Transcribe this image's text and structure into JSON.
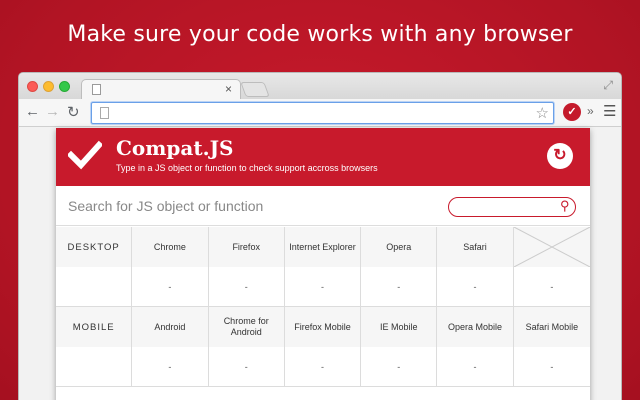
{
  "headline": "Make sure your code works with any browser",
  "browser": {
    "tab_close": "×",
    "star": "☆",
    "extension_glyph": "✓",
    "overflow": "»",
    "menu": "☰"
  },
  "popup": {
    "title": "Compat.JS",
    "subtitle": "Type in a JS object or function to check support accross browsers",
    "refresh_glyph": "↻",
    "search_placeholder": "Search for JS object or function",
    "accent_color": "#c81a2c"
  },
  "table": {
    "desktop": {
      "label": "DESKTOP",
      "browsers": [
        "Chrome",
        "Firefox",
        "Internet Explorer",
        "Opera",
        "Safari"
      ],
      "values": [
        "-",
        "-",
        "-",
        "-",
        "-",
        "-"
      ]
    },
    "mobile": {
      "label": "MOBILE",
      "browsers": [
        "Android",
        "Chrome for Android",
        "Firefox Mobile",
        "IE Mobile",
        "Opera Mobile",
        "Safari Mobile"
      ],
      "values": [
        "-",
        "-",
        "-",
        "-",
        "-",
        "-"
      ]
    }
  }
}
